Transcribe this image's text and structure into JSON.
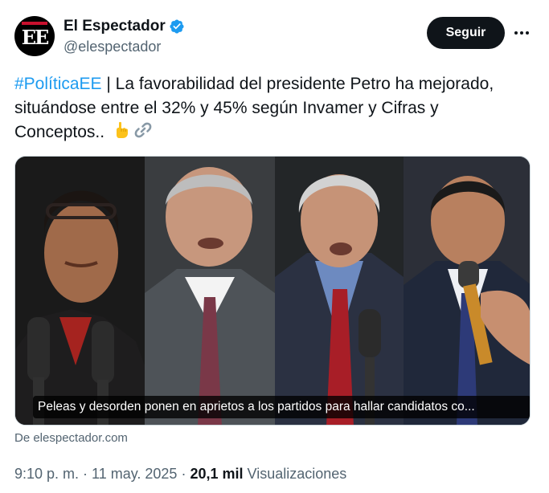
{
  "author": {
    "display_name": "El Espectador",
    "handle": "@elespectador",
    "avatar_text": "EE",
    "verified": true,
    "verified_color": "#1d9bf0"
  },
  "actions": {
    "follow_label": "Seguir",
    "more_icon": "more-horizontal-icon"
  },
  "tweet": {
    "hashtag": "#PolíticaEE",
    "text_after_hashtag": " | La favorabilidad del presidente Petro ha mejorado, situándose entre el 32% y 45% según Invamer y Cifras y Conceptos.. ",
    "emojis": [
      "backhand-index-pointing-down-icon",
      "link-icon"
    ],
    "link_color": "#1d9bf0"
  },
  "media": {
    "caption": "Peleas y desorden ponen en aprietos a los partidos para hallar candidatos co...",
    "source": "De elespectador.com"
  },
  "meta": {
    "time": "9:10 p. m.",
    "separator": " · ",
    "date": "11 may. 2025",
    "views_count": "20,1 mil",
    "views_label": "Visualizaciones"
  }
}
